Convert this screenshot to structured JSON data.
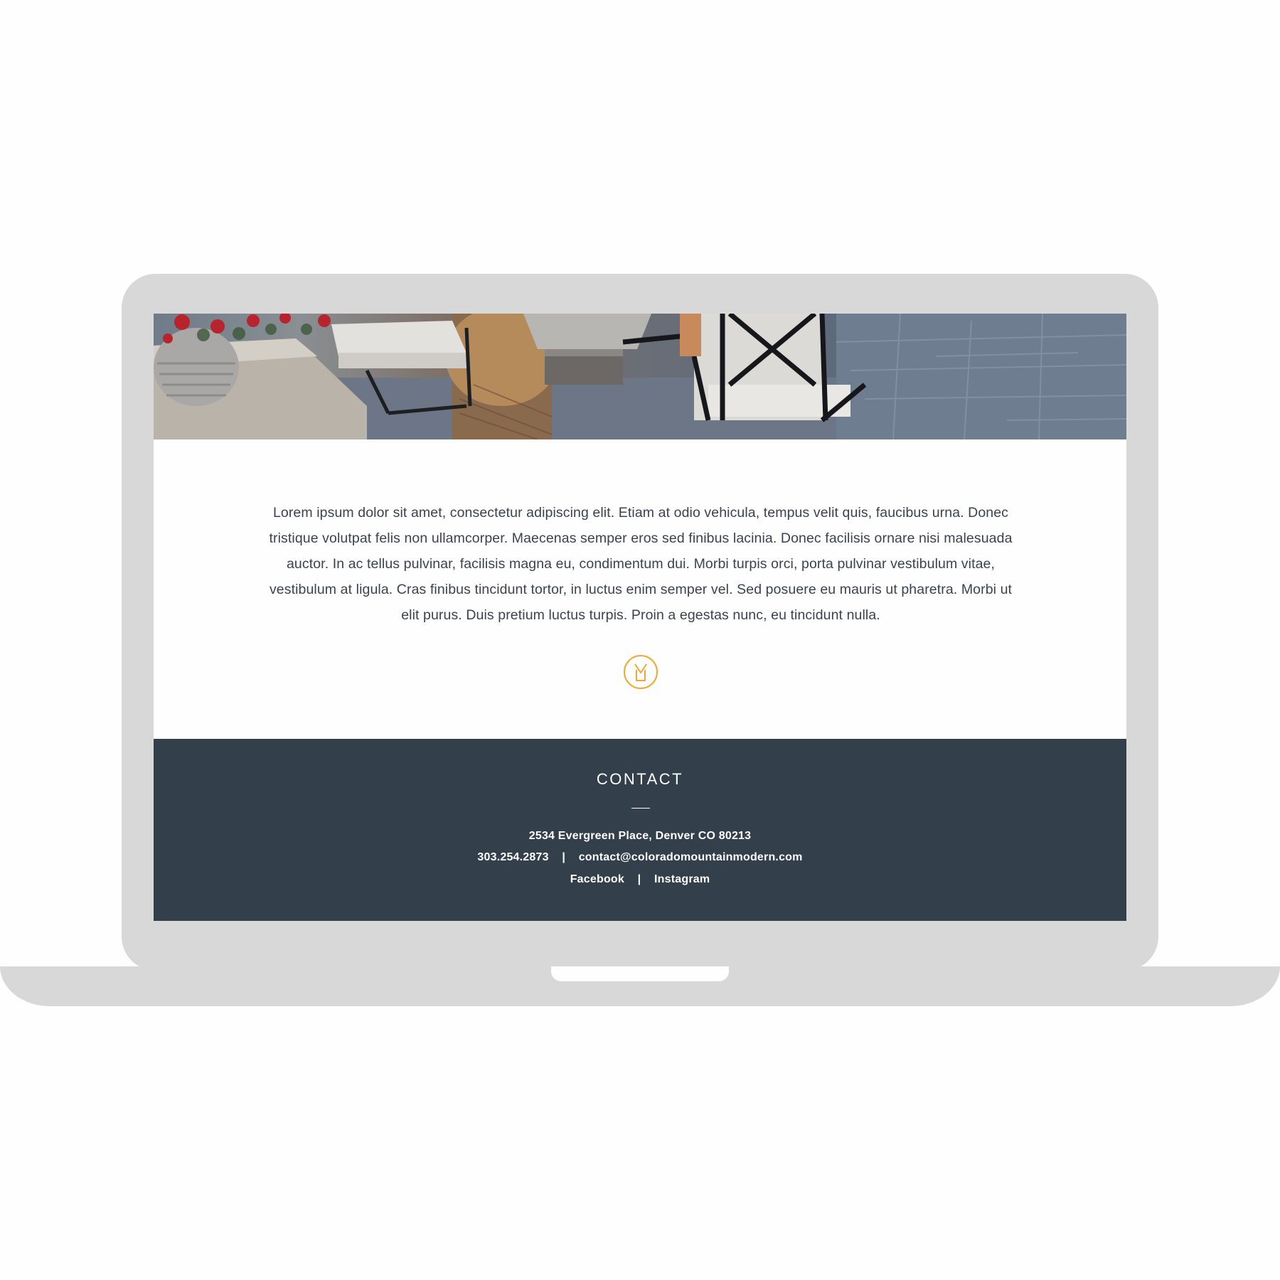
{
  "intro": {
    "paragraph": "Lorem ipsum dolor sit amet, consectetur adipiscing elit. Etiam at odio vehicula, tempus velit quis, faucibus urna. Donec tristique volutpat felis non ullamcorper. Maecenas semper eros sed finibus lacinia. Donec facilisis ornare nisi malesuada auctor. In ac tellus pulvinar, facilisis magna eu, condimentum dui. Morbi turpis orci, porta pulvinar vestibulum vitae, vestibulum at ligula. Cras finibus tincidunt tortor, in luctus enim semper vel. Sed posuere eu mauris ut pharetra. Morbi ut elit purus. Duis pretium luctus turpis. Proin a egestas nunc, eu tincidunt nulla."
  },
  "logo": {
    "icon": "m-monogram-icon",
    "color": "#f0a832"
  },
  "contact": {
    "title": "CONTACT",
    "address": "2534 Evergreen Place, Denver CO 80213",
    "phone": "303.254.2873",
    "separator": "|",
    "email": "contact@coloradomountainmodern.com",
    "social": [
      "Facebook",
      "Instagram"
    ],
    "background": "#333f4a"
  },
  "frame_color": "#d8d8d8"
}
